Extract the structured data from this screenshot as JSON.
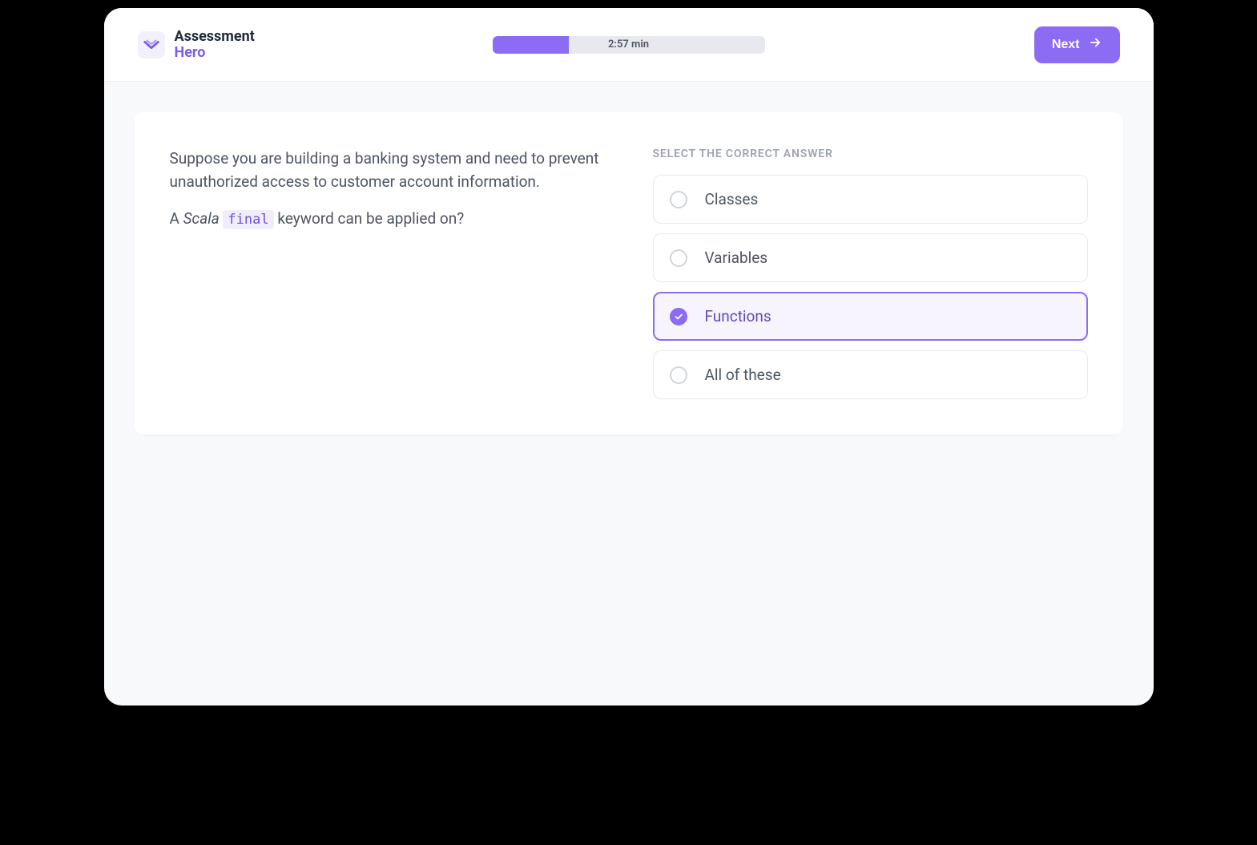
{
  "brand": {
    "line1": "Assessment",
    "line2": "Hero"
  },
  "progress": {
    "time_label": "2:57 min",
    "percent": 28
  },
  "next_button": {
    "label": "Next"
  },
  "question": {
    "context": "Suppose you are building a banking system and need to prevent unauthorized access to customer account information.",
    "prompt_prefix": "A ",
    "prompt_italic": "Scala ",
    "prompt_code": "final",
    "prompt_suffix": " keyword can be applied on?"
  },
  "answers": {
    "title": "SELECT THE CORRECT ANSWER",
    "options": [
      {
        "label": "Classes",
        "selected": false
      },
      {
        "label": "Variables",
        "selected": false
      },
      {
        "label": "Functions",
        "selected": true
      },
      {
        "label": "All of these",
        "selected": false
      }
    ]
  },
  "colors": {
    "accent": "#8b6cf2"
  }
}
